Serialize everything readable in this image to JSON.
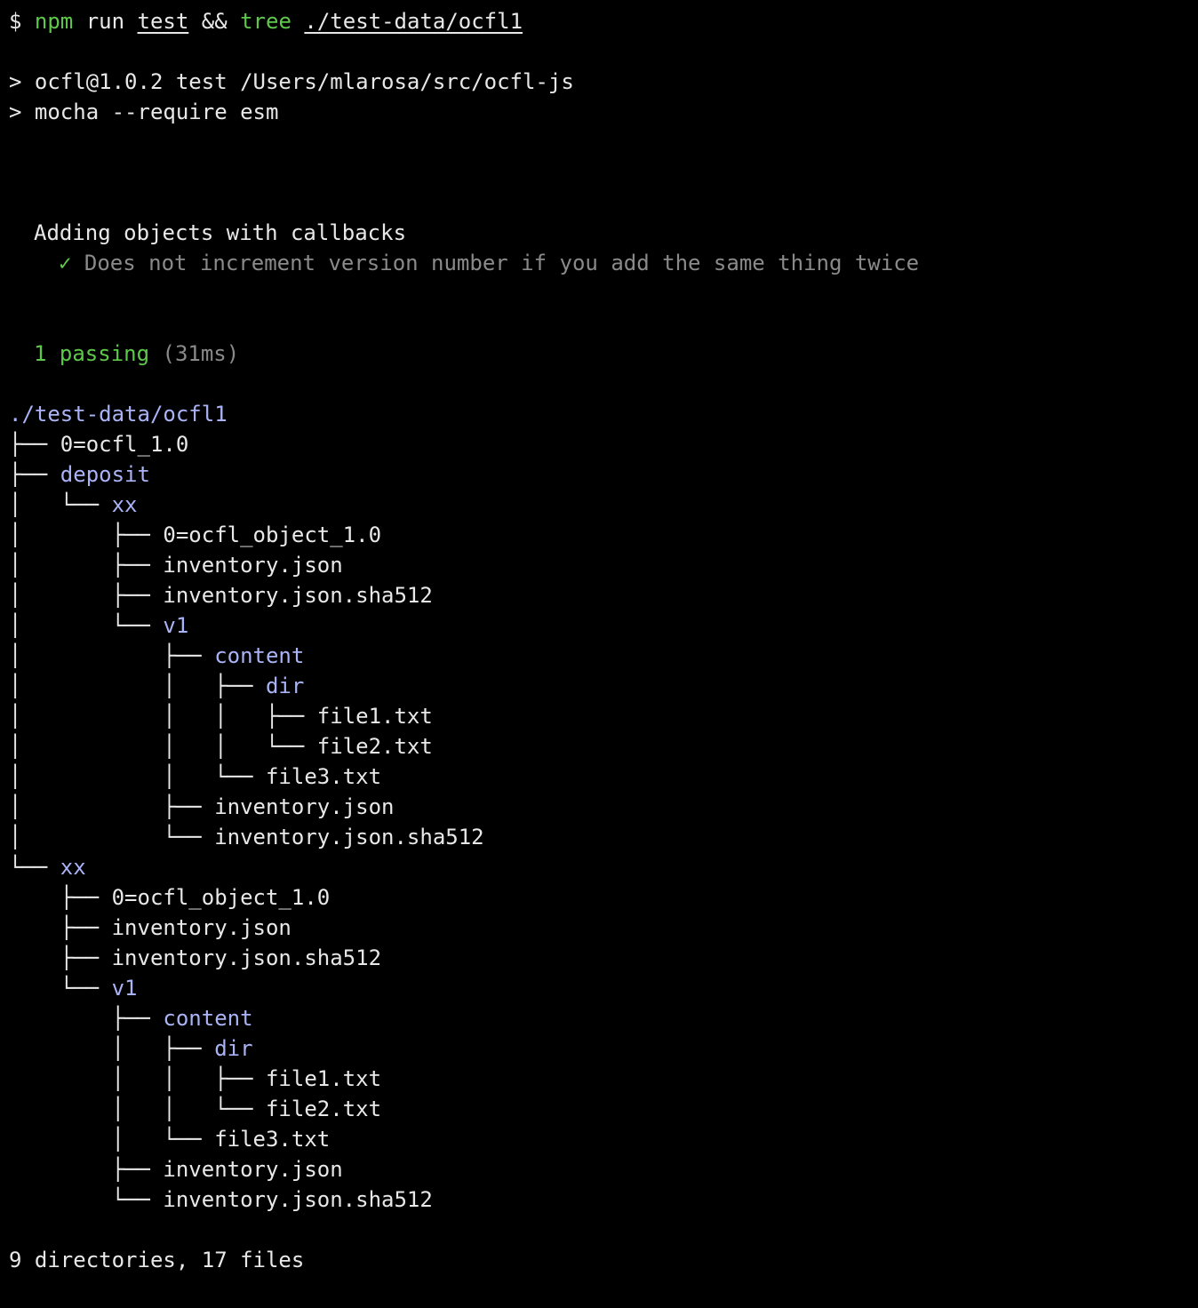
{
  "colors": {
    "background": "#000000",
    "text": "#e8e8e8",
    "green": "#5ec84a",
    "directory": "#a9b3f5",
    "dim": "#8a8a8a"
  },
  "command": {
    "prompt": "$",
    "npm": "npm",
    "run": "run",
    "test": "test",
    "and": "&&",
    "tree": "tree",
    "path": "./test-data/ocfl1"
  },
  "script_header": {
    "line1": "> ocfl@1.0.2 test /Users/mlarosa/src/ocfl-js",
    "line2": "> mocha --require esm"
  },
  "mocha": {
    "suite": "Adding objects with callbacks",
    "check_icon": "checkmark-icon",
    "check_glyph": "✓",
    "test_title": "Does not increment version number if you add the same thing twice",
    "passing": "1 passing",
    "duration": "(31ms)"
  },
  "tree": {
    "root": "./test-data/ocfl1",
    "entries": [
      {
        "prefix": "├── ",
        "name": "0=ocfl_1.0",
        "dir": false
      },
      {
        "prefix": "├── ",
        "name": "deposit",
        "dir": true
      },
      {
        "prefix": "│   └── ",
        "name": "xx",
        "dir": true
      },
      {
        "prefix": "│       ├── ",
        "name": "0=ocfl_object_1.0",
        "dir": false
      },
      {
        "prefix": "│       ├── ",
        "name": "inventory.json",
        "dir": false
      },
      {
        "prefix": "│       ├── ",
        "name": "inventory.json.sha512",
        "dir": false
      },
      {
        "prefix": "│       └── ",
        "name": "v1",
        "dir": true
      },
      {
        "prefix": "│           ├── ",
        "name": "content",
        "dir": true
      },
      {
        "prefix": "│           │   ├── ",
        "name": "dir",
        "dir": true
      },
      {
        "prefix": "│           │   │   ├── ",
        "name": "file1.txt",
        "dir": false
      },
      {
        "prefix": "│           │   │   └── ",
        "name": "file2.txt",
        "dir": false
      },
      {
        "prefix": "│           │   └── ",
        "name": "file3.txt",
        "dir": false
      },
      {
        "prefix": "│           ├── ",
        "name": "inventory.json",
        "dir": false
      },
      {
        "prefix": "│           └── ",
        "name": "inventory.json.sha512",
        "dir": false
      },
      {
        "prefix": "└── ",
        "name": "xx",
        "dir": true
      },
      {
        "prefix": "    ├── ",
        "name": "0=ocfl_object_1.0",
        "dir": false
      },
      {
        "prefix": "    ├── ",
        "name": "inventory.json",
        "dir": false
      },
      {
        "prefix": "    ├── ",
        "name": "inventory.json.sha512",
        "dir": false
      },
      {
        "prefix": "    └── ",
        "name": "v1",
        "dir": true
      },
      {
        "prefix": "        ├── ",
        "name": "content",
        "dir": true
      },
      {
        "prefix": "        │   ├── ",
        "name": "dir",
        "dir": true
      },
      {
        "prefix": "        │   │   ├── ",
        "name": "file1.txt",
        "dir": false
      },
      {
        "prefix": "        │   │   └── ",
        "name": "file2.txt",
        "dir": false
      },
      {
        "prefix": "        │   └── ",
        "name": "file3.txt",
        "dir": false
      },
      {
        "prefix": "        ├── ",
        "name": "inventory.json",
        "dir": false
      },
      {
        "prefix": "        └── ",
        "name": "inventory.json.sha512",
        "dir": false
      }
    ],
    "summary": "9 directories, 17 files"
  }
}
